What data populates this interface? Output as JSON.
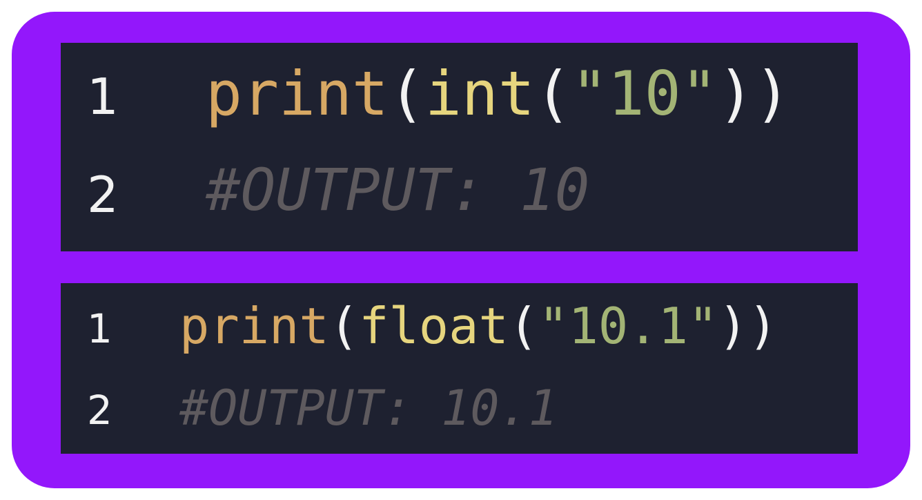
{
  "colors": {
    "frame": "#9317fb",
    "panel_bg": "#1e2130",
    "line_number": "#f2f2f2",
    "function": "#d7a864",
    "builtin": "#e6d57e",
    "paren": "#f2f2f2",
    "string": "#a3b475",
    "comment": "#5e5a5e"
  },
  "snippets": [
    {
      "lines": [
        {
          "number": "1",
          "tokens": {
            "fn": "print",
            "open1": "(",
            "builtin": "int",
            "open2": "(",
            "str": "\"10\"",
            "close": "))"
          }
        },
        {
          "number": "2",
          "comment": "#OUTPUT: 10"
        }
      ]
    },
    {
      "lines": [
        {
          "number": "1",
          "tokens": {
            "fn": "print",
            "open1": "(",
            "builtin": "float",
            "open2": "(",
            "str": "\"10.1\"",
            "close": "))"
          }
        },
        {
          "number": "2",
          "comment": "#OUTPUT: 10.1"
        }
      ]
    }
  ]
}
